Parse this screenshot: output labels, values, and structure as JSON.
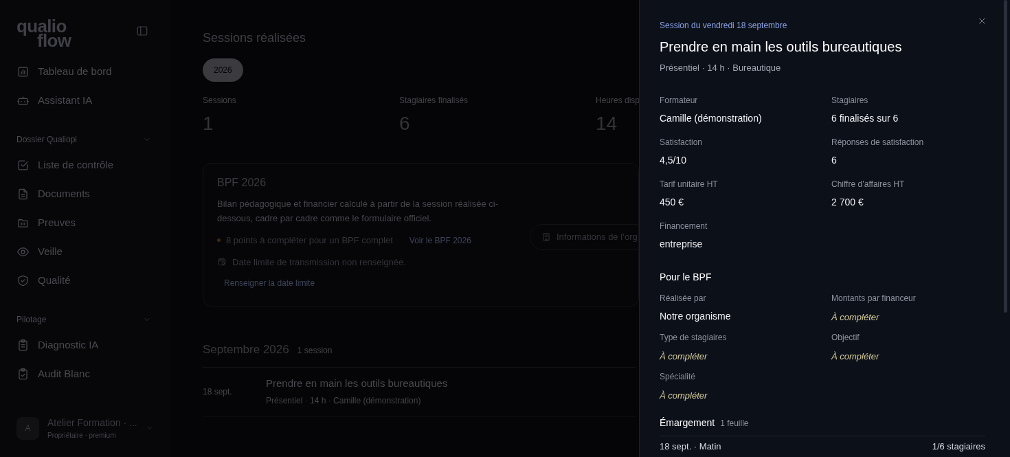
{
  "sidebar": {
    "logo": [
      "qualio",
      "flow"
    ],
    "groups": [
      {
        "items": [
          {
            "label": "Tableau de bord"
          },
          {
            "label": "Assistant IA"
          }
        ]
      },
      {
        "title": "Dossier Qualiopi",
        "expanded": true,
        "items": [
          {
            "label": "Liste de contrôle"
          },
          {
            "label": "Documents"
          },
          {
            "label": "Preuves"
          },
          {
            "label": "Veille"
          },
          {
            "label": "Qualité"
          }
        ]
      },
      {
        "title": "Pilotage",
        "expanded": true,
        "items": [
          {
            "label": "Diagnostic IA"
          },
          {
            "label": "Audit Blanc"
          }
        ]
      }
    ],
    "user": {
      "initial": "A",
      "name": "Atelier Formation · ...",
      "role": "Propriétaire · premium"
    }
  },
  "main": {
    "title": "Sessions réalisées",
    "years": [
      {
        "label": "2026",
        "selected": true
      }
    ],
    "stats": [
      {
        "label": "Sessions",
        "value": "1"
      },
      {
        "label": "Stagiaires finalisés",
        "value": "6"
      },
      {
        "label": "Heures disp",
        "value": "14"
      }
    ],
    "bpf": {
      "title": "BPF 2026",
      "description": "Bilan pédagogique et financier calculé à partir de la session réalisée ci-dessous, cadre par cadre comme le formulaire officiel.",
      "todo": "8 points à compléter pour un BPF complet",
      "todo_link": "Voir le BPF 2026",
      "deadline": "Date limite de transmission non renseignée.",
      "deadline_link": "Renseigner la date limite",
      "org_button": "Informations de l’org"
    },
    "month": {
      "title": "Septembre 2026",
      "count": "1 session",
      "sessions": [
        {
          "date": "18 sept.",
          "title": "Prendre en main les outils bureautiques",
          "meta": "Présentiel · 14 h · Camille (démonstration)"
        }
      ]
    }
  },
  "drawer": {
    "eyebrow": "Session du vendredi 18 septembre",
    "title": "Prendre en main les outils bureautiques",
    "meta": "Présentiel · 14 h · Bureautique",
    "fields": [
      {
        "label": "Formateur",
        "value": "Camille (démonstration)",
        "kind": "value"
      },
      {
        "label": "Stagiaires",
        "value": "6 finalisés sur 6",
        "kind": "value"
      },
      {
        "label": "Satisfaction",
        "value": "4,5/10",
        "kind": "value"
      },
      {
        "label": "Réponses de satisfaction",
        "value": "6",
        "kind": "value"
      },
      {
        "label": "Tarif unitaire HT",
        "value": "450 €",
        "kind": "value"
      },
      {
        "label": "Chiffre d’affaires HT",
        "value": "2 700 €",
        "kind": "value"
      },
      {
        "label": "Financement",
        "value": "entreprise",
        "kind": "value"
      }
    ],
    "bpf_title": "Pour le BPF",
    "bpf_fields": [
      {
        "label": "Réalisée par",
        "value": "Notre organisme",
        "kind": "value"
      },
      {
        "label": "Montants par financeur",
        "value": "À compléter",
        "kind": "missing"
      },
      {
        "label": "Type de stagiaires",
        "value": "À compléter",
        "kind": "missing"
      },
      {
        "label": "Objectif",
        "value": "À compléter",
        "kind": "missing"
      },
      {
        "label": "Spécialité",
        "value": "À compléter",
        "kind": "missing"
      }
    ],
    "sign_title": "Émargement",
    "sign_count": "1 feuille",
    "sheets": [
      {
        "label": "18 sept. · Matin",
        "count": "1/6 stagiaires"
      }
    ]
  }
}
